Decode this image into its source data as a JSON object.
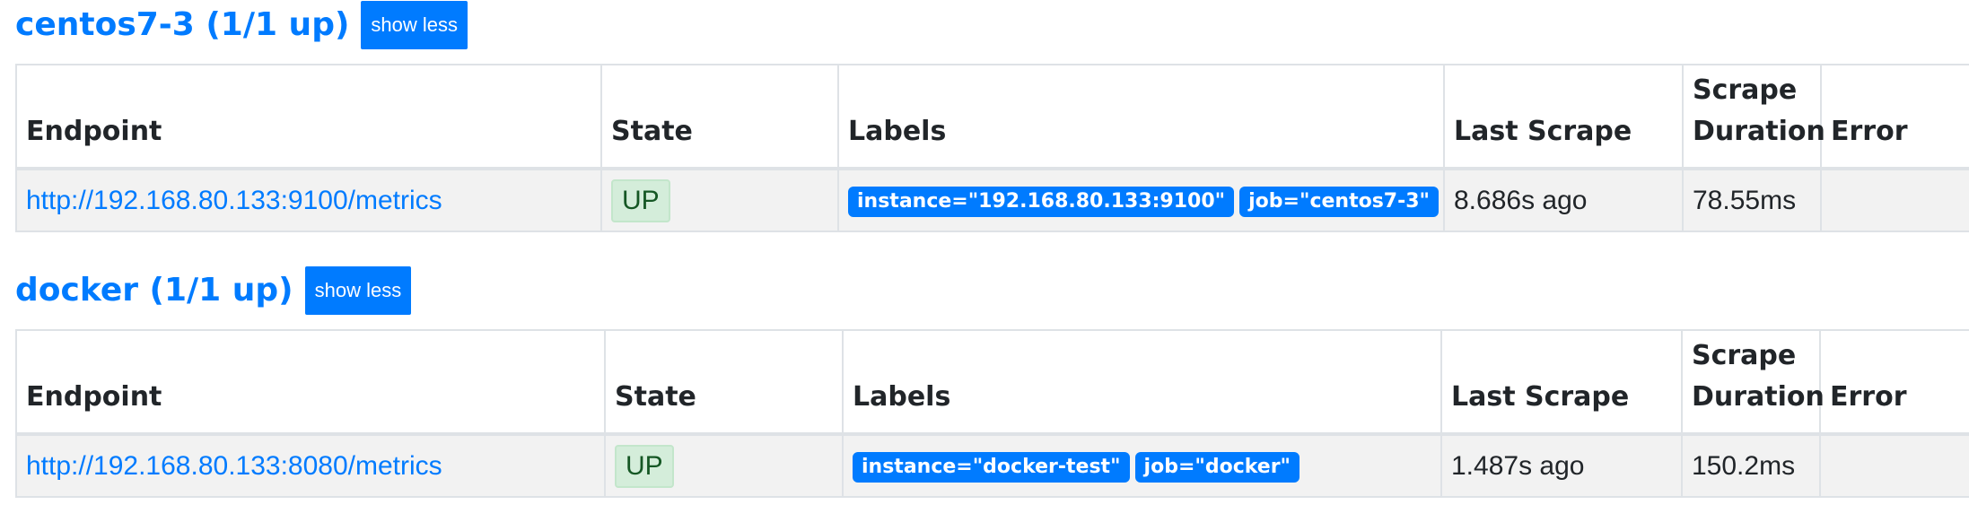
{
  "jobs": [
    {
      "title": "centos7-3 (1/1 up)",
      "toggle_label": "show less",
      "headers": {
        "endpoint": "Endpoint",
        "state": "State",
        "labels": "Labels",
        "last_scrape": "Last Scrape",
        "scrape_duration_line1": "Scrape",
        "scrape_duration_line2": "Duration",
        "error": "Error"
      },
      "rows": [
        {
          "endpoint": "http://192.168.80.133:9100/metrics",
          "state": "UP",
          "labels": [
            "instance=\"192.168.80.133:9100\"",
            "job=\"centos7-3\""
          ],
          "last_scrape": "8.686s ago",
          "scrape_duration": "78.55ms",
          "error": ""
        }
      ]
    },
    {
      "title": "docker (1/1 up)",
      "toggle_label": "show less",
      "headers": {
        "endpoint": "Endpoint",
        "state": "State",
        "labels": "Labels",
        "last_scrape": "Last Scrape",
        "scrape_duration_line1": "Scrape",
        "scrape_duration_line2": "Duration",
        "error": "Error"
      },
      "rows": [
        {
          "endpoint": "http://192.168.80.133:8080/metrics",
          "state": "UP",
          "labels": [
            "instance=\"docker-test\"",
            "job=\"docker\""
          ],
          "last_scrape": "1.487s ago",
          "scrape_duration": "150.2ms",
          "error": ""
        }
      ]
    }
  ],
  "colors": {
    "link": "#007bff",
    "button": "#007bff",
    "up_badge_bg": "#d4edda",
    "up_badge_text": "#155724",
    "row_bg": "#f2f2f2"
  }
}
